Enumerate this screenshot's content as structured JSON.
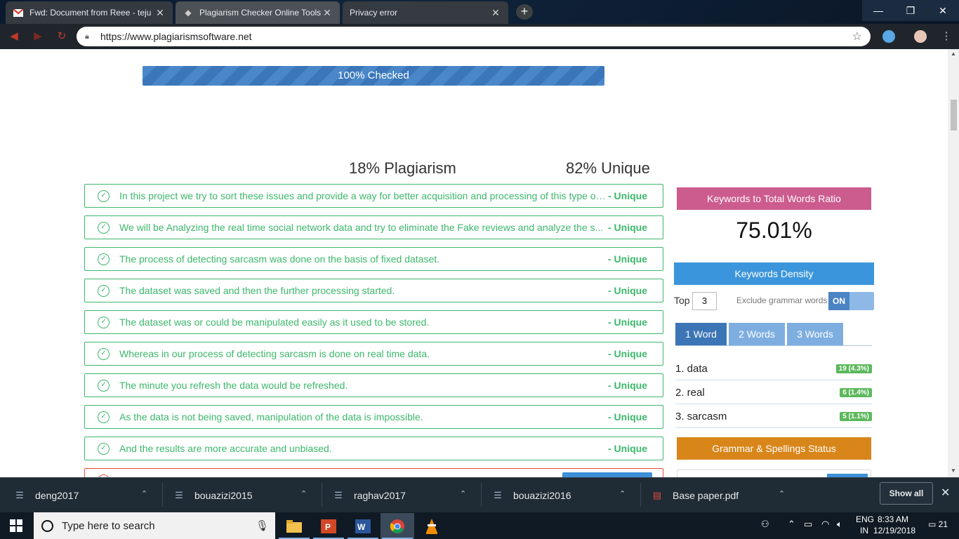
{
  "browser": {
    "tabs": [
      {
        "title": "Fwd: Document from Reee - teju",
        "icon": "gmail-icon"
      },
      {
        "title": "Plagiarism Checker Online Tools",
        "icon": "diamond-icon"
      },
      {
        "title": "Privacy error",
        "icon": "none"
      }
    ],
    "new_tab": "+",
    "url": "https://www.plagiarismsoftware.net",
    "window": {
      "minimize": "—",
      "maximize": "❐",
      "close": "✕"
    }
  },
  "page": {
    "progress_label": "100% Checked",
    "progress_fraction": 1.0,
    "plagiarism_stat": "18% Plagiarism",
    "unique_stat": "82% Unique",
    "sentences": [
      {
        "text": "In this project we try to sort these issues and provide a way for better acquisition and processing of this type of...",
        "status": "- Unique"
      },
      {
        "text": "We will be Analyzing the real time social network data and try to eliminate the Fake reviews and analyze the s...",
        "status": "- Unique"
      },
      {
        "text": "The process of detecting sarcasm was done on the basis of fixed dataset.",
        "status": "- Unique"
      },
      {
        "text": "The dataset was saved and then the further processing started.",
        "status": "- Unique"
      },
      {
        "text": "The dataset was or could be manipulated easily as it used to be stored.",
        "status": "- Unique"
      },
      {
        "text": "Whereas in our process of detecting sarcasm is done on real time data.",
        "status": "- Unique"
      },
      {
        "text": "The minute you refresh the data would be refreshed.",
        "status": "- Unique"
      },
      {
        "text": "As the data is not being saved, manipulation of the data is impossible.",
        "status": "- Unique"
      },
      {
        "text": "And the results are more accurate and unbiased.",
        "status": "- Unique"
      }
    ],
    "sidebar": {
      "ratio_title": "Keywords to Total Words Ratio",
      "ratio_value": "75.01%",
      "density_title": "Keywords Density",
      "top_label": "Top",
      "top_value": "3",
      "exclude_label": "Exclude grammar words",
      "toggle_label": "ON",
      "word_tabs": [
        "1 Word",
        "2 Words",
        "3 Words"
      ],
      "keywords": [
        {
          "label": "1. data",
          "count": "19 (4.3%)"
        },
        {
          "label": "2. real",
          "count": "6 (1.4%)"
        },
        {
          "label": "3. sarcasm",
          "count": "5 (1.1%)"
        }
      ],
      "grammar_title": "Grammar & Spellings Status"
    }
  },
  "downloads": {
    "items": [
      "deng2017",
      "bouazizi2015",
      "raghav2017",
      "bouazizi2016",
      "Base paper.pdf"
    ],
    "show_all": "Show all",
    "close": "✕"
  },
  "taskbar": {
    "search_placeholder": "Type here to search",
    "lang_top": "ENG",
    "lang_bottom": "IN",
    "time": "8:33 AM",
    "date": "12/19/2018",
    "notifications": "21"
  },
  "colors": {
    "unique_green": "#3cb86b",
    "plagiarism_red": "#e74c3c",
    "ratio_pink": "#cc5b8e",
    "density_blue": "#3b95dc",
    "grammar_orange": "#d8861a"
  }
}
